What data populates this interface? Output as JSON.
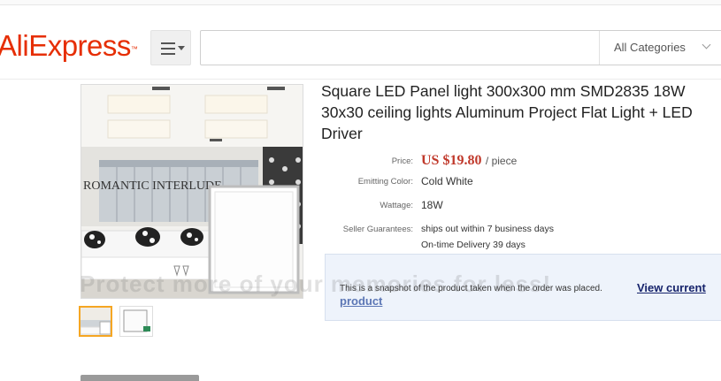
{
  "header": {
    "logo": {
      "part1": "Ali",
      "part2": "Express",
      "tm": "™"
    },
    "menu_icon": "menu-icon",
    "search": {
      "value": "",
      "category": "All Categories"
    }
  },
  "product": {
    "title": "Square LED Panel light 300x300 mm SMD2835 18W 30x30 ceiling lights Aluminum Project Flat Light + LED Driver",
    "image_text": "ROMANTIC INTERLUDE",
    "price_label": "Price:",
    "price_value": "US $19.80",
    "price_unit": "/ piece",
    "color_label": "Emitting Color:",
    "color_value": "Cold White",
    "wattage_label": "Wattage:",
    "wattage_value": "18W",
    "guarantee_label": "Seller Guarantees:",
    "guarantee_line1": "ships out within 7 business days",
    "guarantee_line2": "On-time Delivery 39 days"
  },
  "snapshot": {
    "message": "This is a snapshot of the product taken when the order was placed.",
    "link_part1": "View current",
    "link_part2": "product"
  },
  "watermark": "Protect more of your memories for less!",
  "colors": {
    "brand_red": "#e62e04",
    "brand_orange": "#f5a623",
    "price_red": "#c0392b",
    "link_blue": "#16236b"
  }
}
